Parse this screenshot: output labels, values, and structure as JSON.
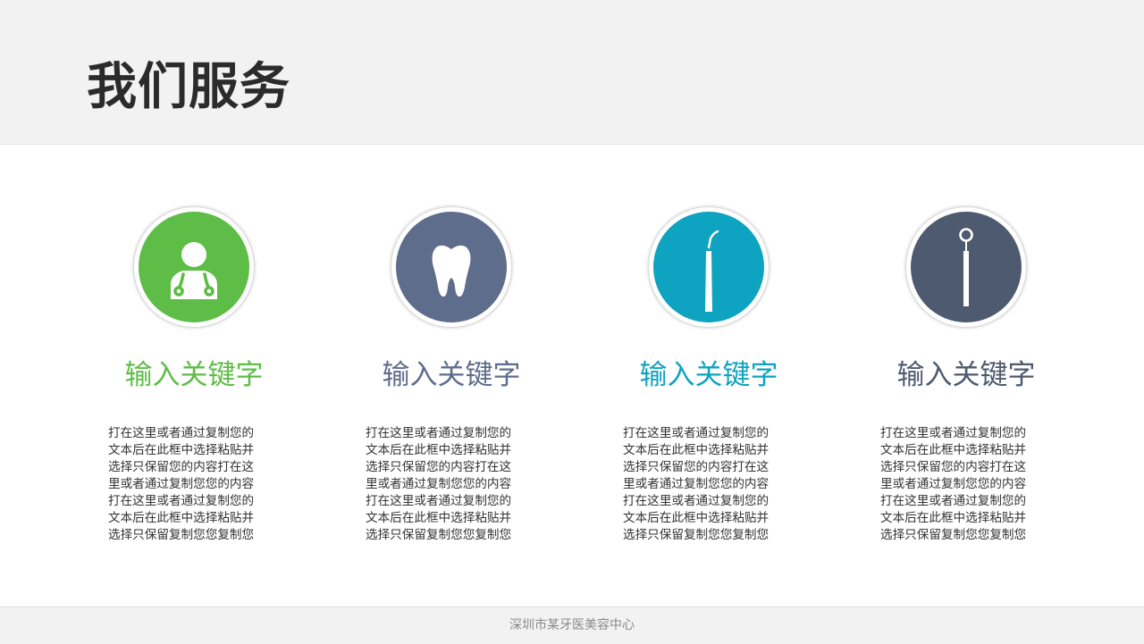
{
  "header": {
    "title": "我们服务"
  },
  "colors": {
    "green": "#5dbd46",
    "slate": "#5f6d8c",
    "teal": "#0ea3c0",
    "navy": "#4e5a70"
  },
  "cards": [
    {
      "icon": "doctor-icon",
      "keyword": "输入关键字",
      "lines": [
        "打在这里或者通过复制您的",
        "文本后在此框中选择粘贴并",
        "选择只保留您的内容打在这",
        "里或者通过复制您您的内容",
        "打在这里或者通过复制您的",
        "文本后在此框中选择粘贴并",
        "选择只保留复制您您复制您"
      ]
    },
    {
      "icon": "tooth-icon",
      "keyword": "输入关键字",
      "lines": [
        "打在这里或者通过复制您的",
        "文本后在此框中选择粘贴并",
        "选择只保留您的内容打在这",
        "里或者通过复制您您的内容",
        "打在这里或者通过复制您的",
        "文本后在此框中选择粘贴并",
        "选择只保留复制您您复制您"
      ]
    },
    {
      "icon": "dental-probe-icon",
      "keyword": "输入关键字",
      "lines": [
        "打在这里或者通过复制您的",
        "文本后在此框中选择粘贴并",
        "选择只保留您的内容打在这",
        "里或者通过复制您您的内容",
        "打在这里或者通过复制您的",
        "文本后在此框中选择粘贴并",
        "选择只保留复制您您复制您"
      ]
    },
    {
      "icon": "dental-mirror-icon",
      "keyword": "输入关键字",
      "lines": [
        "打在这里或者通过复制您的",
        "文本后在此框中选择粘贴并",
        "选择只保留您的内容打在这",
        "里或者通过复制您您的内容",
        "打在这里或者通过复制您的",
        "文本后在此框中选择粘贴并",
        "选择只保留复制您您复制您"
      ]
    }
  ],
  "footer": {
    "text": "深圳市某牙医美容中心"
  }
}
